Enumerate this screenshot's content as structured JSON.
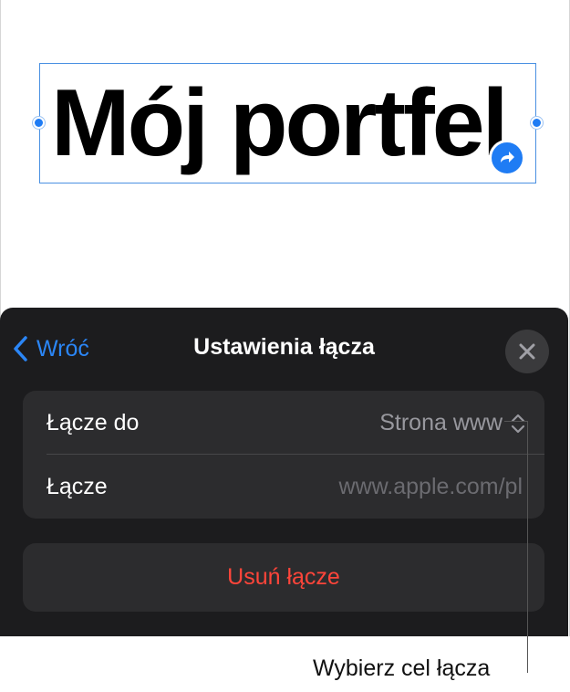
{
  "canvas": {
    "title_text": "Mój portfel"
  },
  "panel": {
    "back_label": "Wróć",
    "title": "Ustawienia łącza",
    "rows": [
      {
        "label": "Łącze do",
        "value": "Strona www"
      },
      {
        "label": "Łącze",
        "placeholder": "www.apple.com/pl"
      }
    ],
    "remove_label": "Usuń łącze"
  },
  "callout": {
    "text": "Wybierz cel łącza"
  },
  "icons": {
    "back": "chevron-left-icon",
    "close": "close-icon",
    "updown": "chevron-up-down-icon",
    "link": "curved-arrow-icon"
  },
  "colors": {
    "accent": "#1f7cf4",
    "panel_bg": "#1c1c1e",
    "group_bg": "#2c2c2e",
    "destructive": "#ff453a"
  }
}
